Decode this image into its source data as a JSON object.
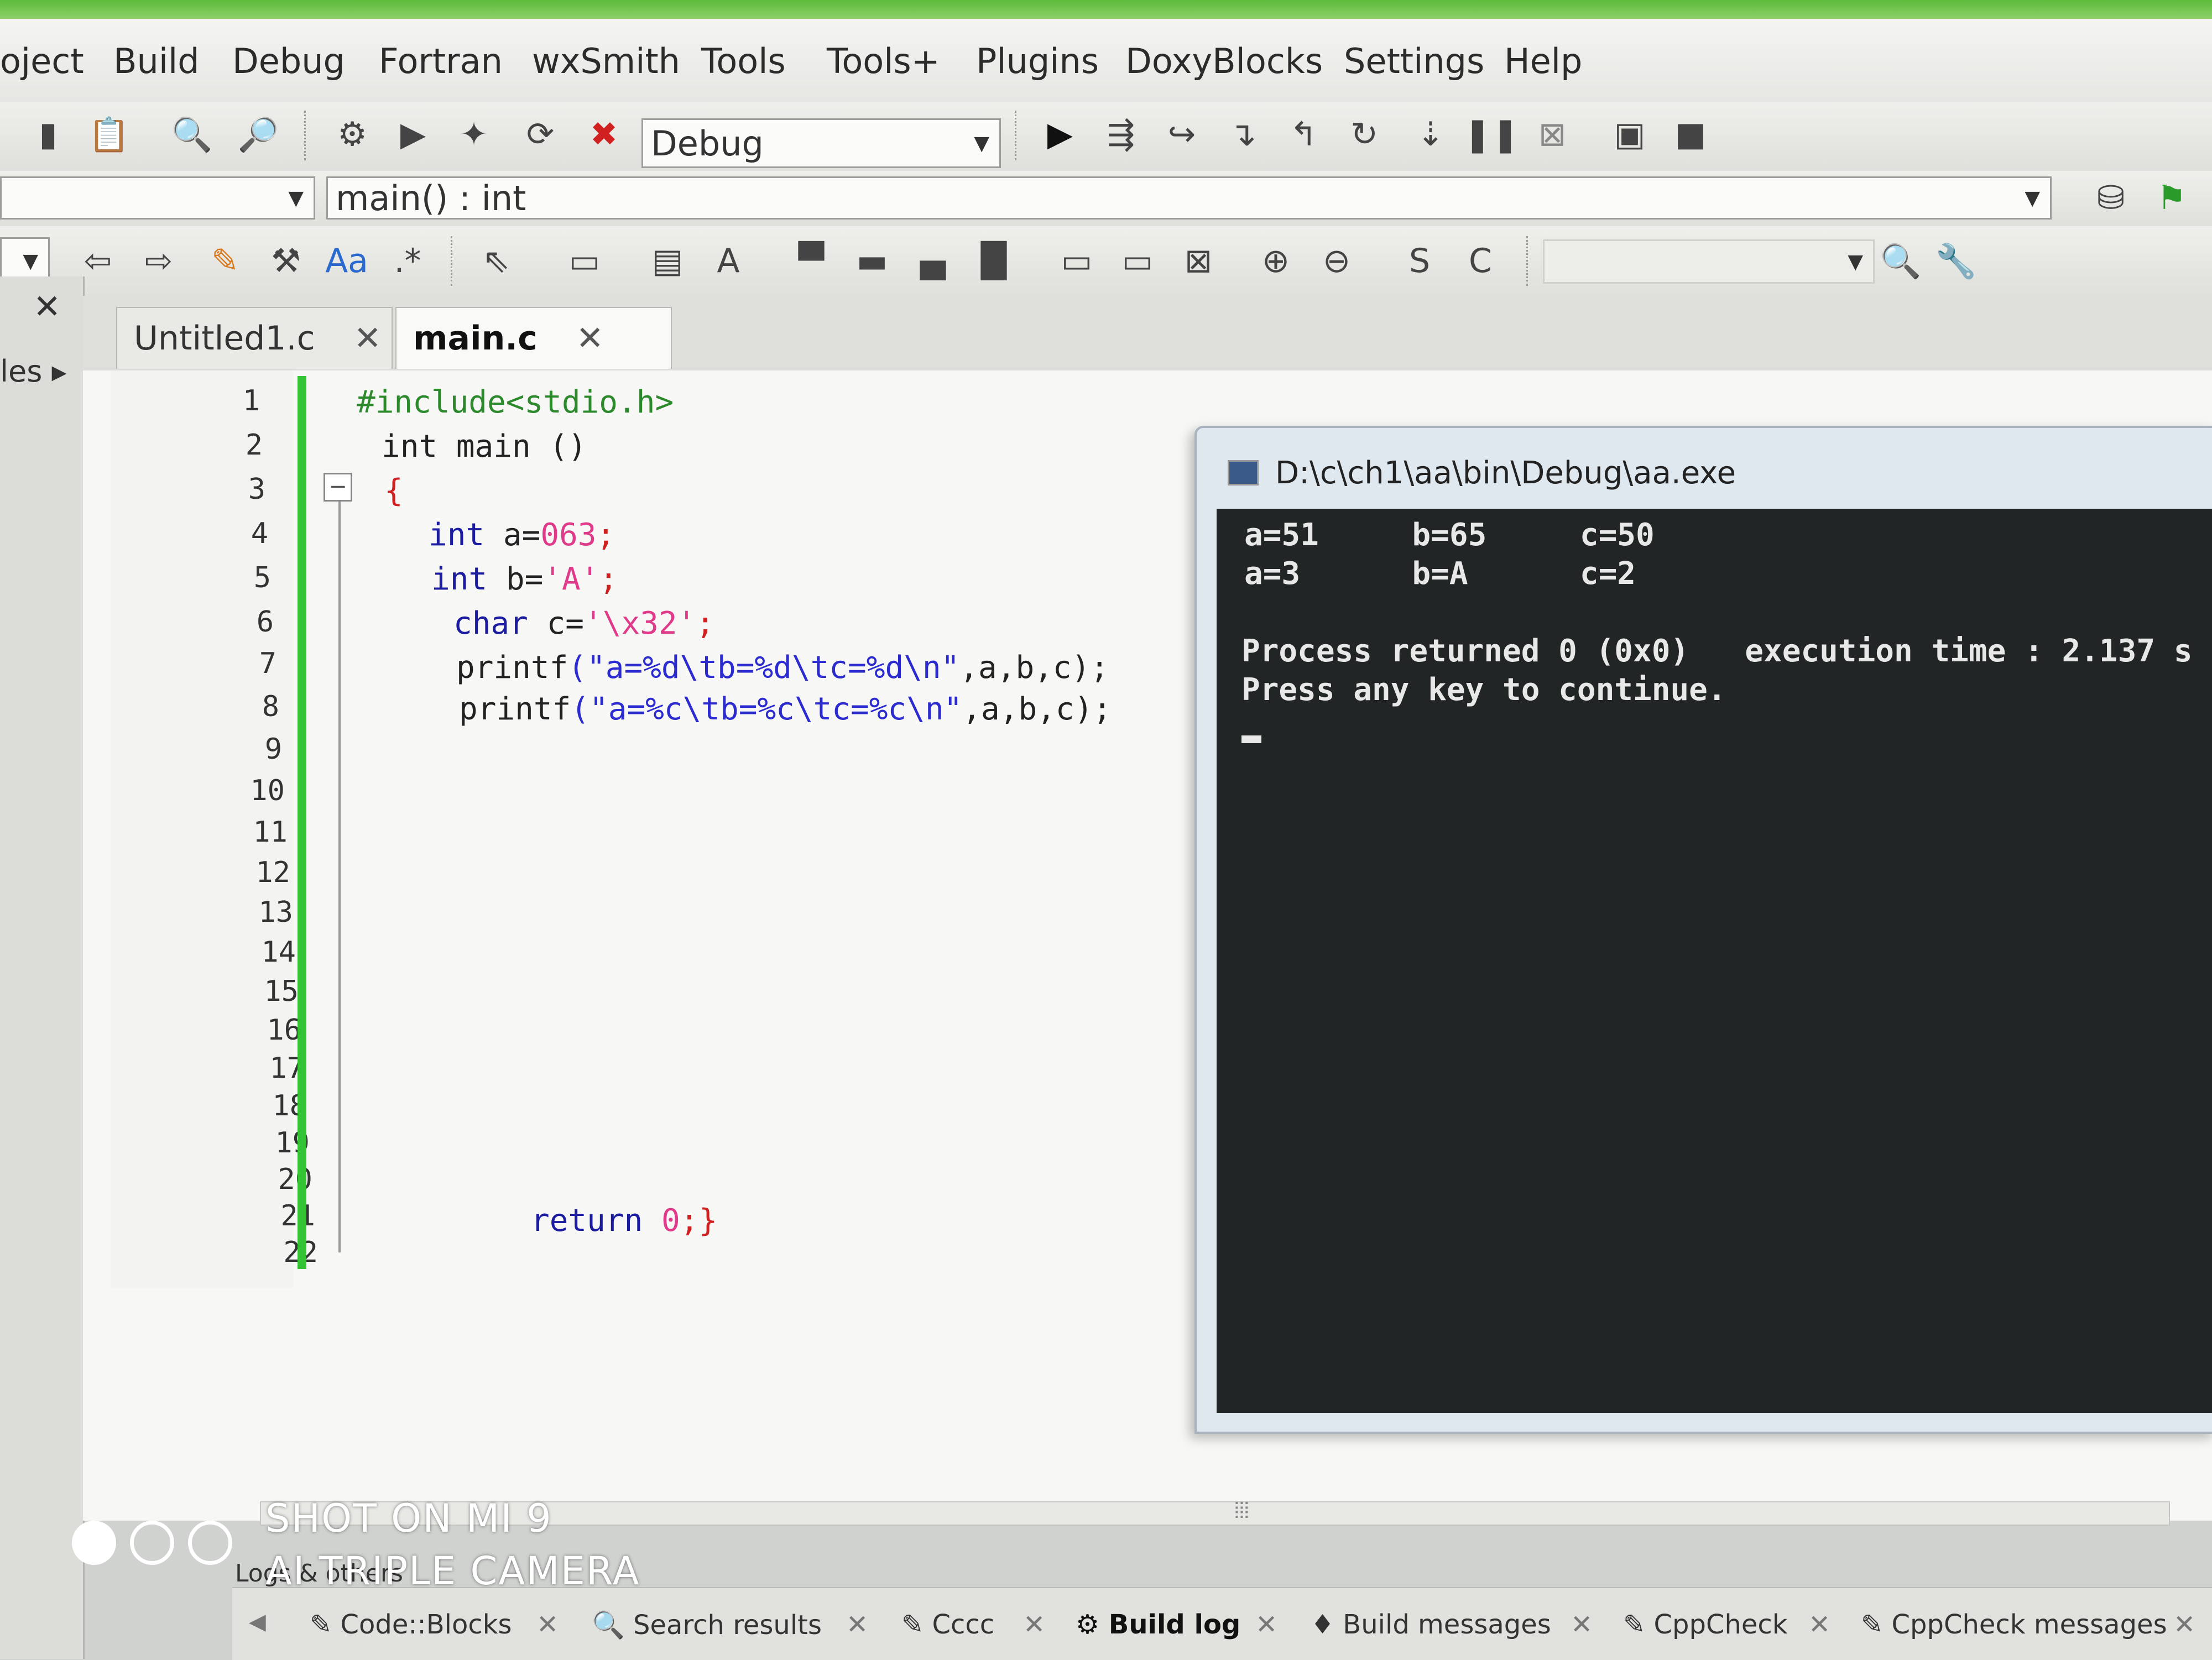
{
  "menubar": {
    "items": [
      "oject",
      "Build",
      "Debug",
      "Fortran",
      "wxSmith",
      "Tools",
      "Tools+",
      "Plugins",
      "DoxyBlocks",
      "Settings",
      "Help"
    ]
  },
  "toolbar": {
    "build_target": "Debug",
    "scope_value": "",
    "function_value": "main() : int"
  },
  "left_panel": {
    "label": "les"
  },
  "tabs": [
    {
      "label": "Untitled1.c",
      "close": "✕"
    },
    {
      "label": "main.c",
      "close": "✕"
    }
  ],
  "editor": {
    "line_numbers": [
      "1",
      "2",
      "3",
      "4",
      "5",
      "6",
      "7",
      "8",
      "9",
      "10",
      "11",
      "12",
      "13",
      "14",
      "15",
      "16",
      "17",
      "18",
      "19",
      "20",
      "21",
      "22"
    ],
    "lines": {
      "l1": "#include<stdio.h>",
      "l2": "int main ()",
      "l3": "{",
      "l4_kw": "int",
      "l4_rest": " a=",
      "l4_val": "063",
      "l4_end": ";",
      "l5_kw": "int",
      "l5_rest": " b=",
      "l5_val": "'A'",
      "l5_end": ";",
      "l6_kw": "char",
      "l6_rest": " c=",
      "l6_val": "'\\x32'",
      "l6_end": ";",
      "l7_fn": "printf",
      "l7_str": "(\"a=%d\\tb=%d\\tc=%d\\n\"",
      "l7_end": ",a,b,c);",
      "l8_fn": "printf",
      "l8_str": "(\"a=%c\\tb=%c\\tc=%c\\n\"",
      "l8_end": ",a,b,c);",
      "l21_kw": "return",
      "l21_val": " 0",
      "l21_end": ";}"
    }
  },
  "console": {
    "title": "D:\\c\\ch1\\aa\\bin\\Debug\\aa.exe",
    "out1": "a=51     b=65     c=50",
    "out2": "a=3      b=A      c=2",
    "process": "Process returned 0 (0x0)   execution time : 2.137 s",
    "press": "Press any key to continue."
  },
  "logs": {
    "label": "Logs & others",
    "tabs": [
      "Code::Blocks",
      "Search results",
      "Cccc",
      "Build log",
      "Build messages",
      "CppCheck",
      "CppCheck messages"
    ],
    "active_tab": "Build log"
  },
  "watermark": {
    "line1": "SHOT ON MI 9",
    "line2": "AI TRIPLE CAMERA"
  },
  "colors": {
    "change_bar": "#35c235",
    "console_bg": "#222526",
    "keyword": "#1c1ca0",
    "number": "#e03a8a"
  }
}
